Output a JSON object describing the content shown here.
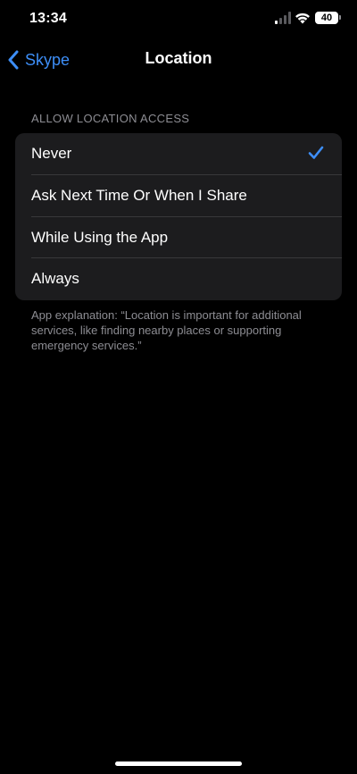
{
  "status_bar": {
    "time": "13:34",
    "battery_level": "40",
    "icons": [
      "signal-icon",
      "wifi-icon",
      "battery-icon"
    ]
  },
  "nav": {
    "back_label": "Skype",
    "back_icon": "chevron-left-icon",
    "title": "Location"
  },
  "section": {
    "header": "ALLOW LOCATION ACCESS",
    "options": [
      {
        "label": "Never",
        "selected": true
      },
      {
        "label": "Ask Next Time Or When I Share",
        "selected": false
      },
      {
        "label": "While Using the App",
        "selected": false
      },
      {
        "label": "Always",
        "selected": false
      }
    ],
    "footer": "App explanation: “Location is important for additional services, like finding nearby places or supporting emergency services.”"
  },
  "colors": {
    "background": "#000000",
    "group_background": "#1c1c1e",
    "accent": "#3d8ef7",
    "secondary_text": "#8d8d93",
    "separator": "#38383a"
  }
}
